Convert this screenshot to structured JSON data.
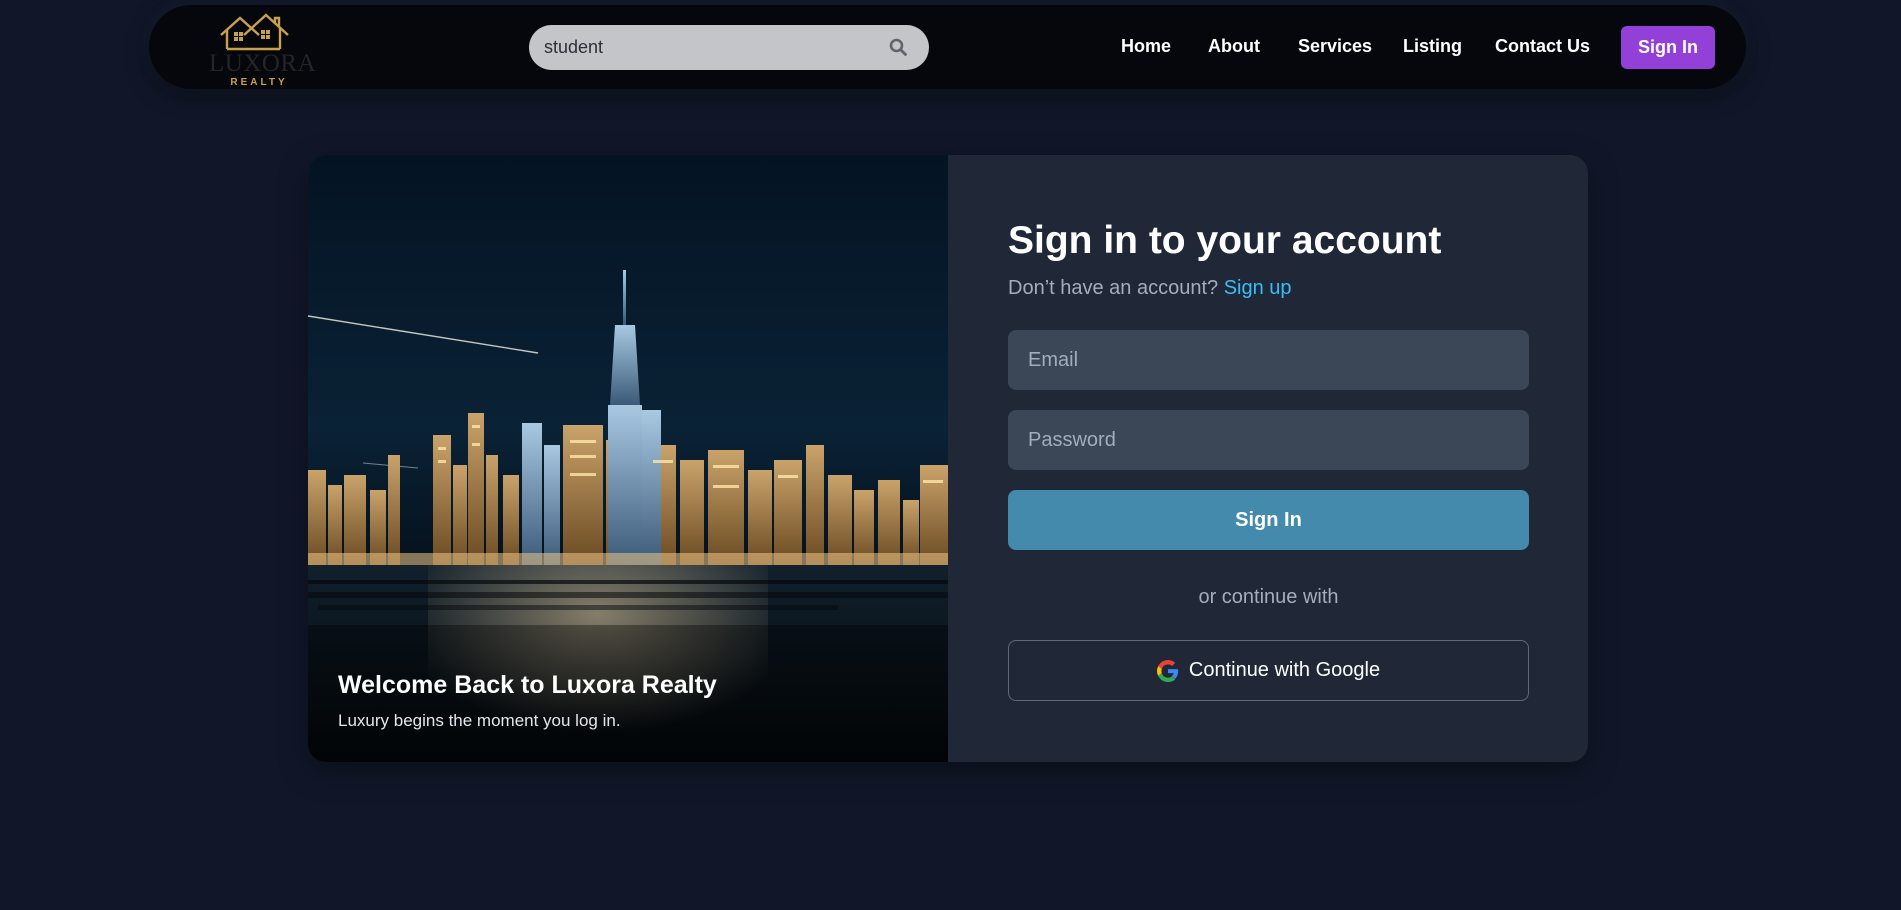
{
  "navbar": {
    "logo": {
      "name": "LUXORA",
      "sub": "REALTY",
      "icon": "house-logo-icon"
    },
    "search": {
      "value": "student",
      "icon": "search-icon"
    },
    "links": [
      "Home",
      "About",
      "Services",
      "Listing",
      "Contact Us"
    ],
    "signin_label": "Sign In"
  },
  "hero": {
    "title": "Welcome Back to Luxora Realty",
    "subtitle": "Luxury begins the moment you log in."
  },
  "form": {
    "title": "Sign in to your account",
    "no_account_text": "Don’t have an account?",
    "signup_label": "Sign up",
    "email_placeholder": "Email",
    "password_placeholder": "Password",
    "signin_label": "Sign In",
    "or_text": "or continue with",
    "google_label": "Continue with Google"
  },
  "colors": {
    "page_bg": "#111729",
    "navbar_bg": "#05070d",
    "accent_purple": "#9340d9",
    "signin_button": "#438aad",
    "link": "#38bdf8",
    "panel_bg": "#202838",
    "input_bg": "#3b4657",
    "logo_gold": "#c9a14a"
  }
}
